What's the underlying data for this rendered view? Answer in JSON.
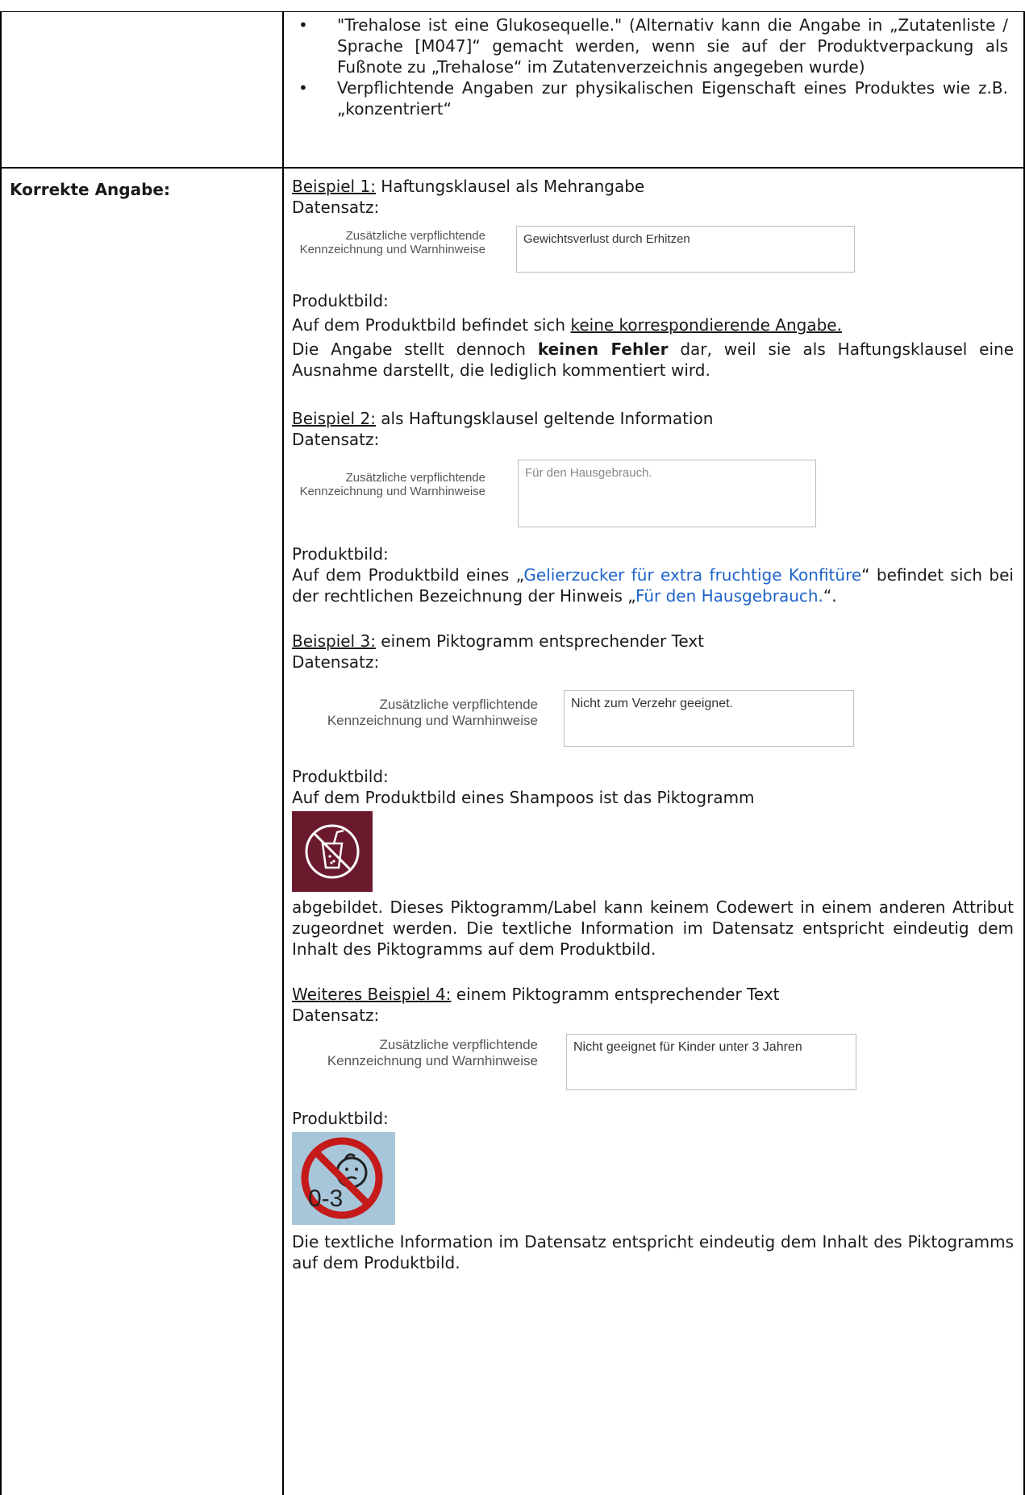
{
  "top_bullets": [
    "\"Trehalose ist eine Glukosequelle.\" (Alternativ kann die Angabe in „Zutatenliste / Sprache [M047]“ gemacht werden, wenn sie auf der Produktverpackung als Fußnote zu „Trehalose“ im Zutatenverzeichnis angegeben wurde)",
    "Verpflichtende Angaben zur physikalischen Eigenschaft eines Produktes wie z.B. „konzentriert“"
  ],
  "section_label": "Korrekte Angabe:",
  "field_label": "Zusätzliche verpflichtende Kennzeichnung und Warnhinweise",
  "datensatz_label": "Datensatz:",
  "produktbild_label": "Produktbild:",
  "ex1": {
    "title_u": "Beispiel 1:",
    "title_rest": " Haftungsklausel als Mehrangabe",
    "field_value": "Gewichtsverlust durch Erhitzen",
    "line1_pre": "Auf dem Produktbild befindet sich ",
    "line1_u": "keine korrespondierende Angabe.",
    "line2_pre": "Die Angabe stellt dennoch ",
    "line2_bold": "keinen Fehler",
    "line2_post": " dar, weil sie als Haftungsklausel eine Ausnahme darstellt, die lediglich kommentiert wird."
  },
  "ex2": {
    "title_u": "Beispiel 2:",
    "title_rest": " als Haftungsklausel geltende Information",
    "field_value": "Für den Hausgebrauch.",
    "p_a": "Auf dem Produktbild eines „",
    "p_link1": "Gelierzucker für extra fruchtige Konfitüre",
    "p_b": "“ befindet sich bei der rechtlichen Bezeichnung der Hinweis „",
    "p_link2": "Für den Hausgebrauch.",
    "p_c": "“."
  },
  "ex3": {
    "title_u": "Beispiel 3:",
    "title_rest": " einem Piktogramm entsprechender Text",
    "field_value": "Nicht zum Verzehr geeignet.",
    "line1": "Auf dem Produktbild eines Shampoos ist das Piktogramm",
    "line2": "abgebildet. Dieses Piktogramm/Label kann keinem Codewert in einem anderen Attribut zugeordnet werden. Die textliche Information im Datensatz entspricht eindeutig dem Inhalt des Piktogramms auf dem Produktbild."
  },
  "ex4": {
    "title_u": "Weiteres Beispiel 4:",
    "title_rest": " einem Piktogramm entsprechender Text",
    "field_value": "Nicht geeignet für Kinder unter 3 Jahren",
    "pict_text": "0-3",
    "line1": "Die textliche Information im Datensatz entspricht eindeutig dem Inhalt des Piktogramms auf dem Produktbild."
  },
  "colors": {
    "pict1_bg": "#6b1a2e",
    "pict2_bg": "#a8c6da",
    "link": "#1e64c8"
  }
}
